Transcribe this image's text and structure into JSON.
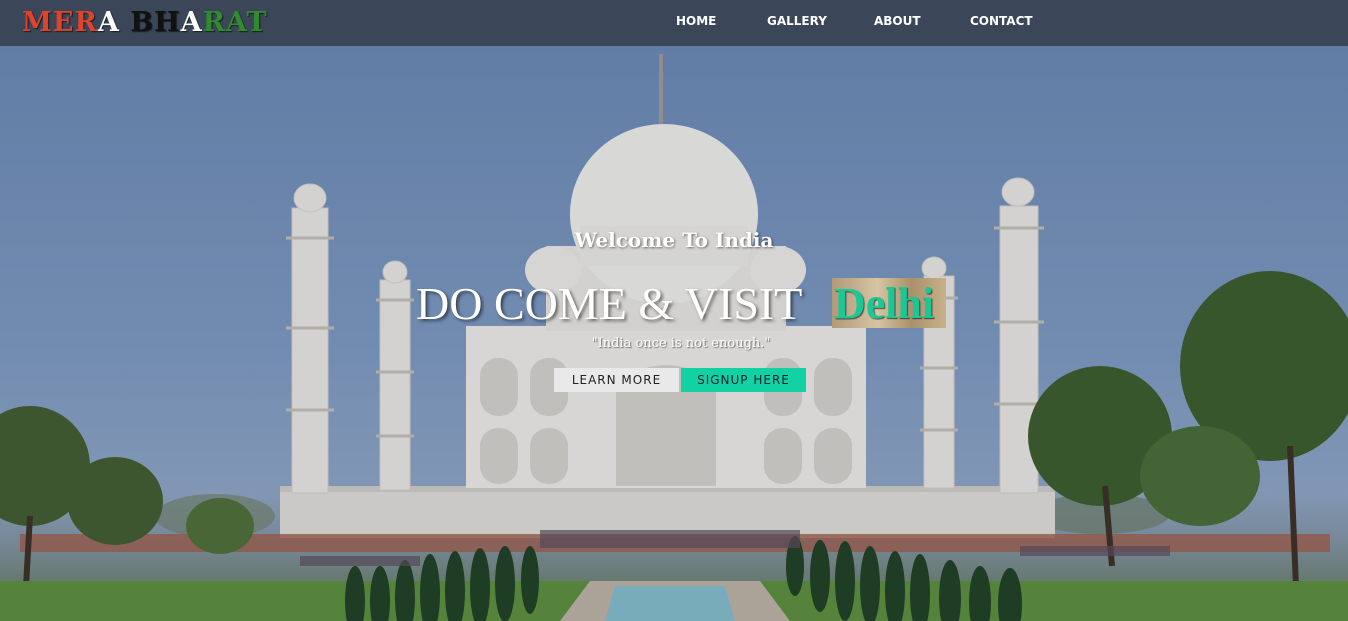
{
  "logo": {
    "parts": [
      {
        "text": "MER",
        "color": "#e0432a"
      },
      {
        "text": "A",
        "color": "#ffffff"
      },
      {
        "text": " ",
        "color": "#ffffff"
      },
      {
        "text": "BH",
        "color": "#111111"
      },
      {
        "text": "A",
        "color": "#ffffff"
      },
      {
        "text": "RAT",
        "color": "#2e8b2e"
      }
    ]
  },
  "nav": {
    "home": "HOME",
    "gallery": "GALLERY",
    "about": "ABOUT",
    "contact": "CONTACT"
  },
  "hero": {
    "welcome": "Welcome To India",
    "headline": "DO COME & VISIT",
    "city": "Delhi",
    "quote": "\"India once is not enough.\"",
    "learn_more": "LEARN MORE",
    "signup": "SIGNUP HERE",
    "accent_color": "#12d1a3"
  }
}
